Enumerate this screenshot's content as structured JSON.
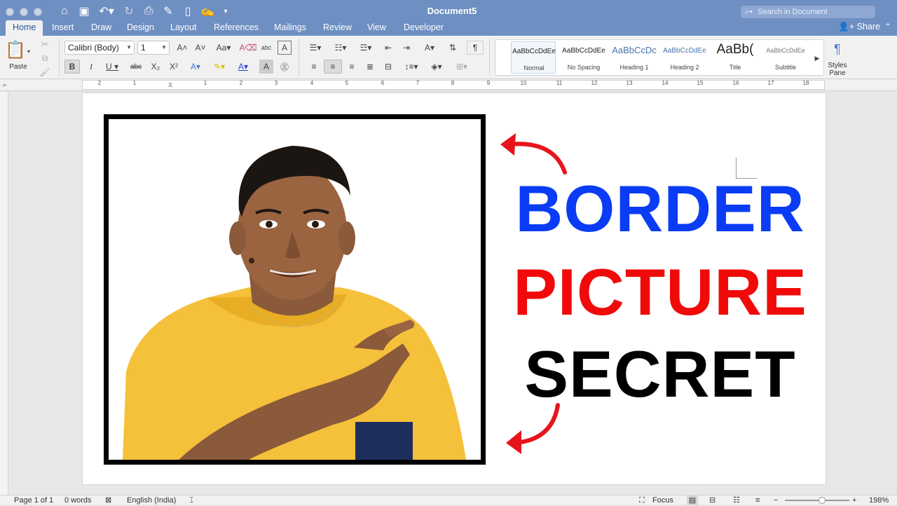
{
  "window": {
    "title": "Document5"
  },
  "search": {
    "placeholder": "Search in Document"
  },
  "tabs": [
    {
      "label": "Home"
    },
    {
      "label": "Insert"
    },
    {
      "label": "Draw"
    },
    {
      "label": "Design"
    },
    {
      "label": "Layout"
    },
    {
      "label": "References"
    },
    {
      "label": "Mailings"
    },
    {
      "label": "Review"
    },
    {
      "label": "View"
    },
    {
      "label": "Developer"
    }
  ],
  "share_label": "Share",
  "ribbon": {
    "paste_label": "Paste",
    "font_name": "Calibri (Body)",
    "font_size": "1",
    "styles": [
      {
        "sample": "AaBbCcDdEe",
        "name": "Normal"
      },
      {
        "sample": "AaBbCcDdEe",
        "name": "No Spacing"
      },
      {
        "sample": "AaBbCcDc",
        "name": "Heading 1"
      },
      {
        "sample": "AaBbCcDdEe",
        "name": "Heading 2"
      },
      {
        "sample": "AaBb(",
        "name": "Title"
      },
      {
        "sample": "AaBbCcDdEe",
        "name": "Subtitle"
      }
    ],
    "styles_pane_label_1": "Styles",
    "styles_pane_label_2": "Pane"
  },
  "ruler": {
    "labels": [
      "2",
      "1",
      "1",
      "2",
      "3",
      "4",
      "5",
      "6",
      "7",
      "8",
      "9",
      "10",
      "11",
      "12",
      "13",
      "14",
      "15",
      "16",
      "17",
      "18"
    ]
  },
  "document": {
    "line1": "BORDER",
    "line2": "PICTURE",
    "line3": "SECRET",
    "line1_color": "#0a3cf5",
    "line2_color": "#f00a0a",
    "line3_color": "#000000",
    "arrow_color": "#e8141c"
  },
  "status": {
    "page": "Page 1 of 1",
    "words": "0 words",
    "language": "English (India)",
    "focus": "Focus",
    "zoom": "198%"
  }
}
